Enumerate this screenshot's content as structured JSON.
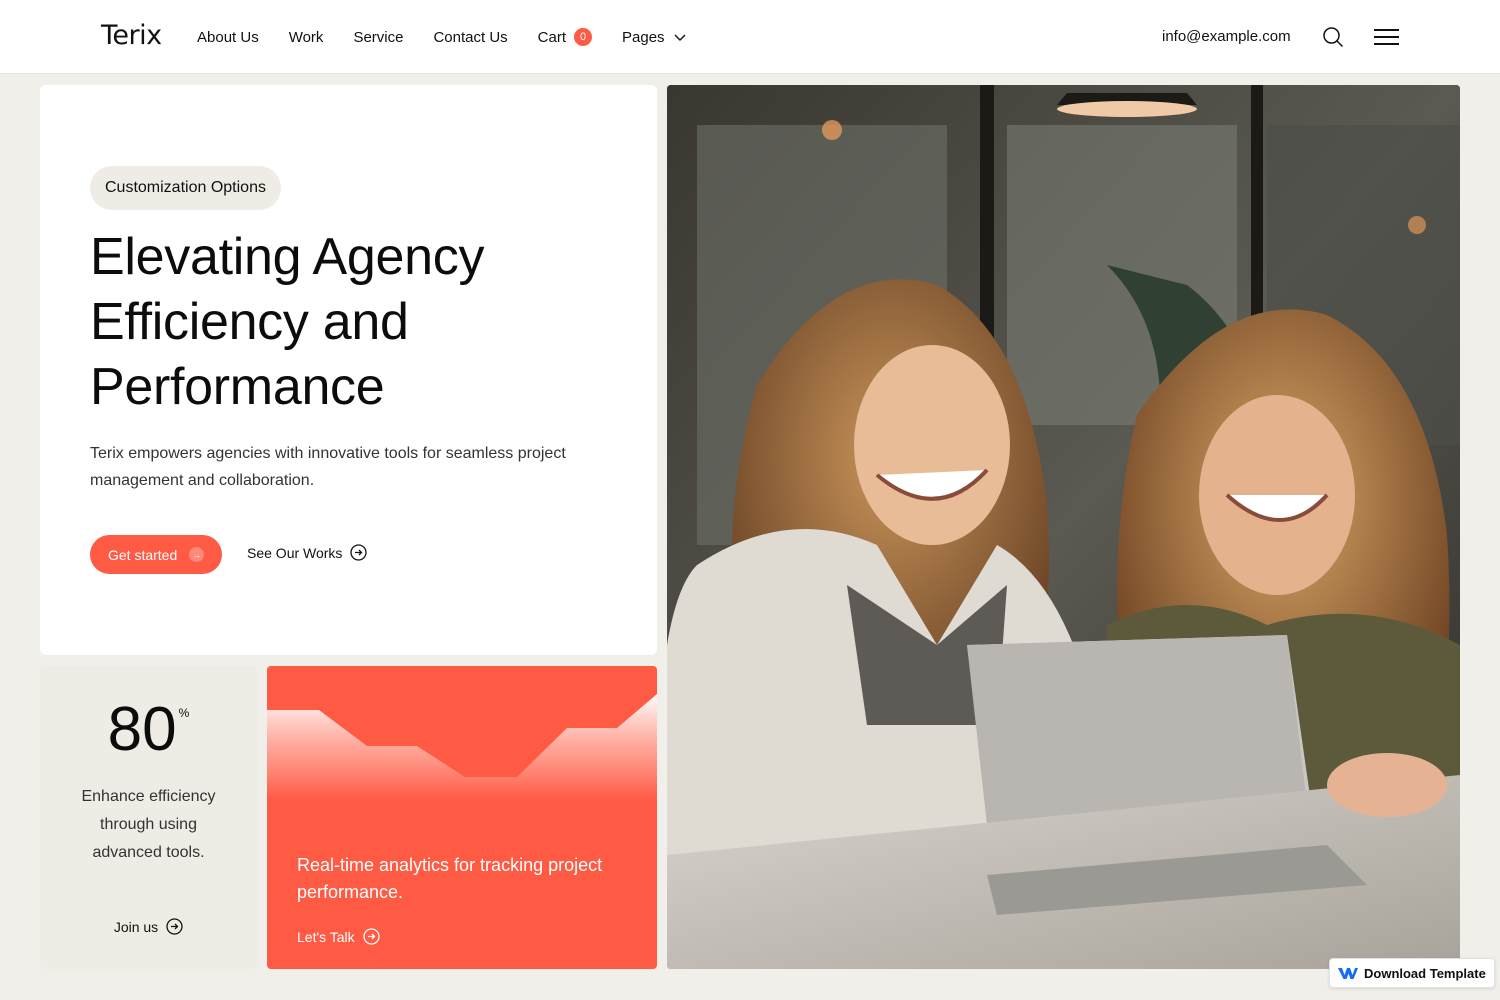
{
  "header": {
    "logo": "Terix",
    "nav": [
      {
        "label": "About Us"
      },
      {
        "label": "Work"
      },
      {
        "label": "Service"
      },
      {
        "label": "Contact Us"
      }
    ],
    "cart": {
      "label": "Cart",
      "count": "0"
    },
    "pages": {
      "label": "Pages"
    },
    "email": "info@example.com"
  },
  "hero": {
    "badge": "Customization Options",
    "title": "Elevating Agency Efficiency and Performance",
    "description": "Terix empowers agencies with innovative tools for seamless project management and collaboration.",
    "primary_button": "Get started",
    "secondary_button": "See Our Works"
  },
  "stat": {
    "value": "80",
    "unit": "%",
    "description": "Enhance efficiency through using advanced tools.",
    "link": "Join us"
  },
  "analytics": {
    "text": "Real-time analytics for tracking project performance.",
    "link": "Let's Talk"
  },
  "badge": {
    "label": "Download Template"
  },
  "colors": {
    "accent": "#ff5a44",
    "background": "#f1efea",
    "card": "#ffffff",
    "muted_card": "#efece6"
  },
  "icons": {
    "search": "search-icon",
    "menu": "hamburger-menu-icon",
    "arrow": "arrow-right-circle-icon",
    "chevron": "chevron-down-icon",
    "webflow": "webflow-logo-icon"
  }
}
